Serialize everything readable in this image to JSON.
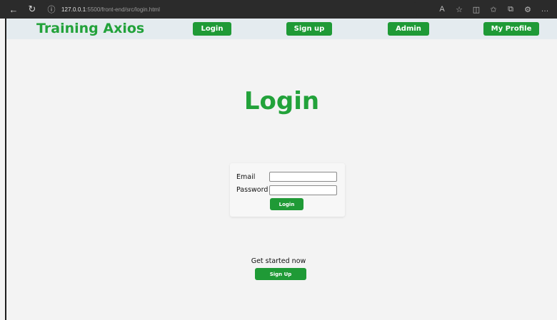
{
  "browser": {
    "url_host": "127.0.0.1",
    "url_path": ":5500/front-end/src/login.html",
    "icons": [
      "back-arrow-icon",
      "reload-icon",
      "info-icon",
      "read-aloud-icon",
      "favorite-icon",
      "split-screen-icon",
      "favorites-icon",
      "collections-icon",
      "extensions-icon",
      "more-icon"
    ]
  },
  "nav": {
    "brand": "Training Axios",
    "login_label": "Login",
    "signup_label": "Sign up",
    "admin_label": "Admin",
    "profile_label": "My Profile"
  },
  "page": {
    "title": "Login"
  },
  "form": {
    "email_label": "Email",
    "email_value": "",
    "password_label": "Password",
    "password_value": "",
    "submit_label": "Login"
  },
  "cta": {
    "text": "Get started now",
    "button_label": "Sign Up"
  },
  "colors": {
    "accent": "#22a23a",
    "button": "#1f9a36",
    "nav_bg": "#e4ebef",
    "page_bg": "#f3f3f3",
    "browser_bar": "#2b2b2b"
  }
}
